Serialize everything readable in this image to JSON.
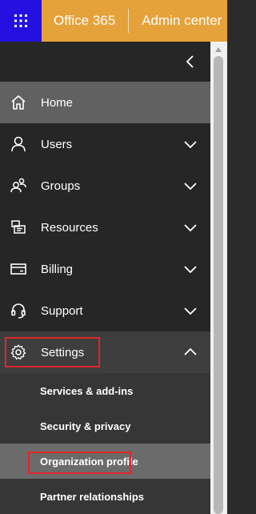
{
  "header": {
    "brand": "Office 365",
    "app_title": "Admin center",
    "accent_color": "#e6a23a",
    "waffle_color": "#2410e0"
  },
  "nav": {
    "items": [
      {
        "label": "Home",
        "icon": "home-icon"
      },
      {
        "label": "Users",
        "icon": "user-icon"
      },
      {
        "label": "Groups",
        "icon": "groups-icon"
      },
      {
        "label": "Resources",
        "icon": "resources-icon"
      },
      {
        "label": "Billing",
        "icon": "credit-card-icon"
      },
      {
        "label": "Support",
        "icon": "headset-icon"
      },
      {
        "label": "Settings",
        "icon": "gear-icon"
      }
    ],
    "settings_sub": [
      {
        "label": "Services & add-ins"
      },
      {
        "label": "Security & privacy"
      },
      {
        "label": "Organization profile"
      },
      {
        "label": "Partner relationships"
      }
    ]
  },
  "highlight_color": "#e0262a"
}
